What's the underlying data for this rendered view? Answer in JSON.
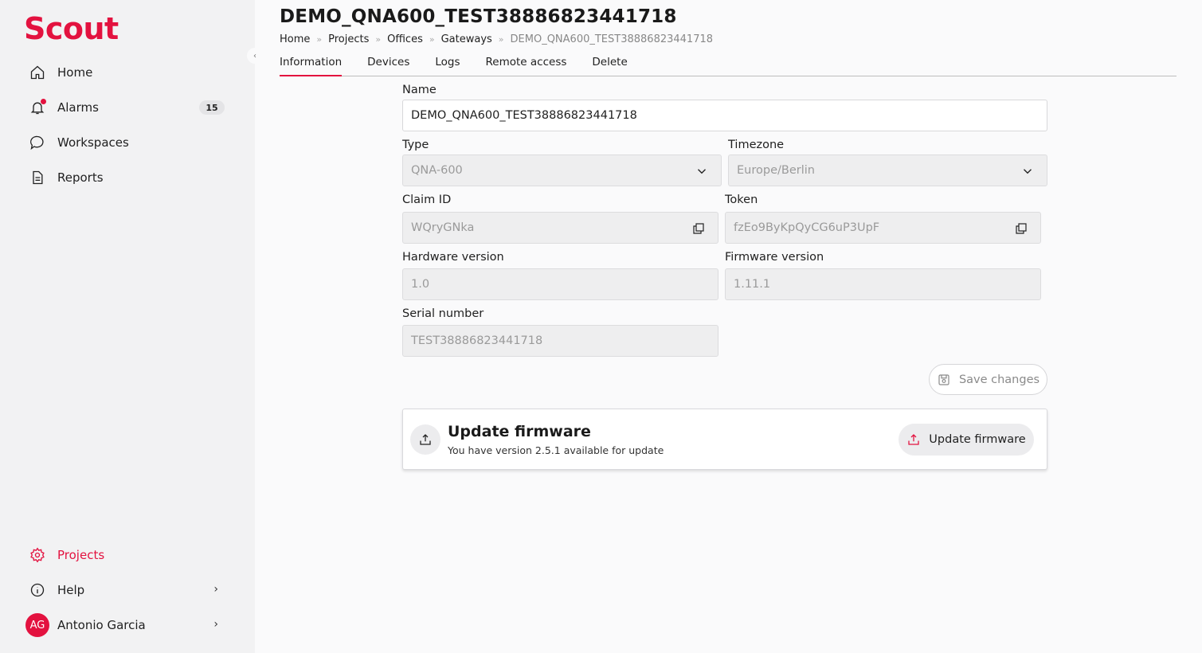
{
  "app": {
    "logo": "Scout"
  },
  "sidebar": {
    "items": [
      {
        "label": "Home",
        "icon": "home-icon"
      },
      {
        "label": "Alarms",
        "icon": "bell-icon",
        "badge": "15"
      },
      {
        "label": "Workspaces",
        "icon": "chat-icon"
      },
      {
        "label": "Reports",
        "icon": "document-icon"
      }
    ],
    "bottom": [
      {
        "label": "Projects",
        "icon": "gear-icon"
      },
      {
        "label": "Help",
        "icon": "info-icon"
      },
      {
        "label": "Antonio Garcia",
        "initials": "AG"
      }
    ],
    "collapse_glyph": "‹"
  },
  "header": {
    "title": "DEMO_QNA600_TEST38886823441718",
    "breadcrumb": [
      "Home",
      "Projects",
      "Offices",
      "Gateways",
      "DEMO_QNA600_TEST38886823441718"
    ],
    "breadcrumb_sep": "»"
  },
  "tabs": [
    "Information",
    "Devices",
    "Logs",
    "Remote access",
    "Delete"
  ],
  "form": {
    "name_label": "Name",
    "name_value": "DEMO_QNA600_TEST38886823441718",
    "type_label": "Type",
    "type_value": "QNA-600",
    "timezone_label": "Timezone",
    "timezone_value": "Europe/Berlin",
    "claim_label": "Claim ID",
    "claim_value": "WQryGNka",
    "token_label": "Token",
    "token_value": "fzEo9ByKpQyCG6uP3UpF",
    "hw_label": "Hardware version",
    "hw_value": "1.0",
    "fw_label": "Firmware version",
    "fw_value": "1.11.1",
    "serial_label": "Serial number",
    "serial_value": "TEST38886823441718",
    "save_label": "Save changes"
  },
  "firmware": {
    "title": "Update firmware",
    "subtitle": "You have version 2.5.1 available for update",
    "button_label": "Update firmware"
  },
  "colors": {
    "accent": "#e3123f"
  }
}
